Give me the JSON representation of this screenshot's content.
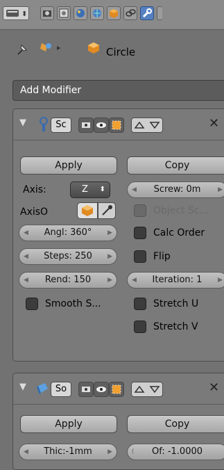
{
  "breadcrumb": {
    "object_name": "Circle"
  },
  "add_modifier": {
    "label": "Add Modifier"
  },
  "screw_panel": {
    "name_short": "Sc",
    "apply_label": "Apply",
    "copy_label": "Copy",
    "axis_label": "Axis:",
    "axis_value": "Z",
    "axis_object_label": "AxisO",
    "screw_field": "Screw: 0m",
    "object_screw_label": "Object Sc...",
    "angle_field": "Angl: 360°",
    "calc_order_label": "Calc Order",
    "steps_field": "Steps: 250",
    "flip_label": "Flip",
    "render_field": "Rend: 150",
    "iterations_field": "Iteration: 1",
    "smooth_label": "Smooth S...",
    "stretch_u_label": "Stretch U",
    "stretch_v_label": "Stretch V"
  },
  "solidify_panel": {
    "name_short": "So",
    "apply_label": "Apply",
    "copy_label": "Copy",
    "thickness_field": "Thic:-1mm",
    "offset_field": "Of: -1.0000"
  },
  "colors": {
    "accent": "#5680c2",
    "panel": "#7a7a7a",
    "background": "#727272"
  },
  "icons": [
    "editor-type-icon",
    "render-icon",
    "scene-icon",
    "world-icon",
    "object-icon",
    "constraint-icon",
    "wrench-icon",
    "pin-icon",
    "object-data-icon",
    "cube-icon",
    "expand-icon",
    "modifier-wrench-icon",
    "realtime-icon",
    "render-toggle-icon",
    "editmode-icon",
    "move-up-icon",
    "move-down-icon",
    "close-icon",
    "eyedropper-icon",
    "solidify-icon"
  ]
}
